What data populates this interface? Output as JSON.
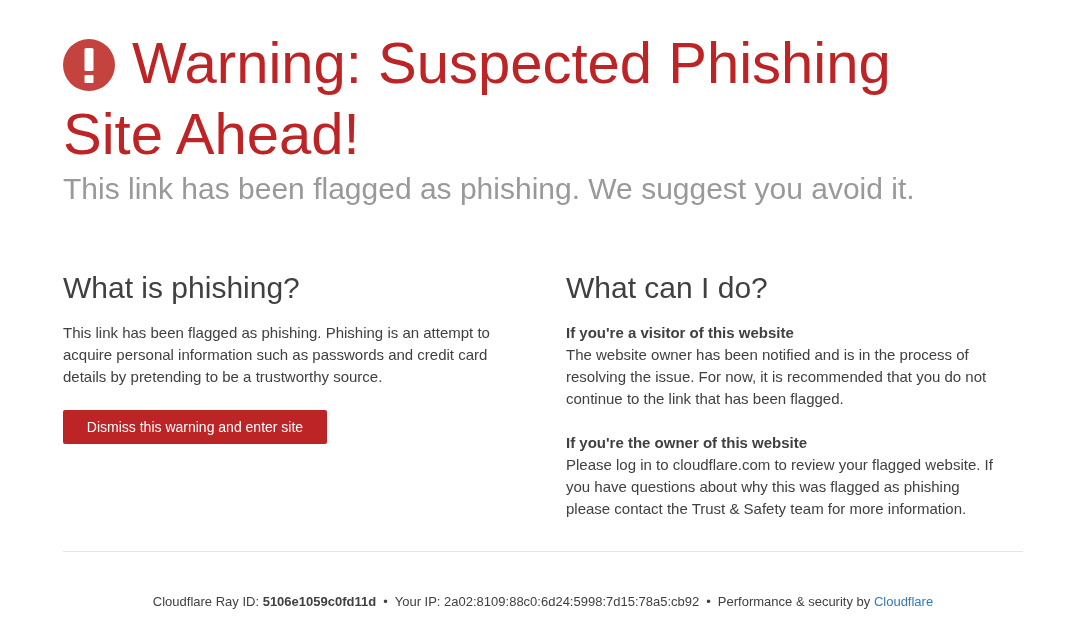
{
  "header": {
    "title_lines": [
      "Warning: Suspected Phishing",
      "Site Ahead!"
    ],
    "subtitle": "This link has been flagged as phishing. We suggest you avoid it."
  },
  "left_column": {
    "heading": "What is phishing?",
    "text": "This link has been flagged as phishing. Phishing is an attempt to acquire personal information such as passwords and credit card details by pretending to be a trustworthy source.",
    "button": "Dismiss this warning and enter site"
  },
  "right_column": {
    "heading": "What can I do?",
    "blocks": [
      {
        "title": "If you're a visitor of this website",
        "text": "The website owner has been notified and is in the process of resolving the issue. For now, it is recommended that you do not continue to the link that has been flagged."
      },
      {
        "title": "If you're the owner of this website",
        "text": "Please log in to cloudflare.com to review your flagged website. If you have questions about why this was flagged as phishing please contact the Trust & Safety team for more information."
      }
    ]
  },
  "footer": {
    "items": [
      {
        "kind": "text",
        "text": "Cloudflare Ray ID: **5106e1059c0fd11d**"
      },
      {
        "kind": "separator",
        "text": "•"
      },
      {
        "kind": "text",
        "text": "Your IP: 2a02:8109:88c0:6d24:5998:7d15:78a5:cb92"
      },
      {
        "kind": "separator",
        "text": "•"
      },
      {
        "kind": "credit",
        "text": "Performance & security by",
        "link": "Cloudflare"
      }
    ]
  }
}
